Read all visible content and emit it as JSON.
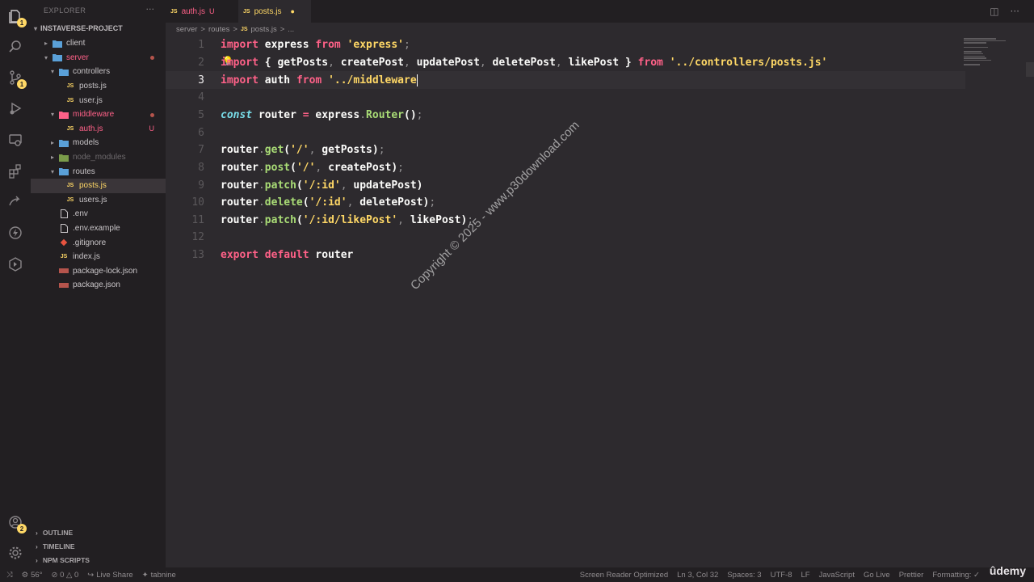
{
  "sidebar": {
    "title": "EXPLORER",
    "more": "···",
    "root": "INSTAVERSE-PROJECT",
    "items": [
      {
        "label": "client",
        "kind": "folder",
        "expanded": false,
        "indent": 1,
        "color": "#c9c5c8"
      },
      {
        "label": "server",
        "kind": "folder",
        "expanded": true,
        "indent": 1,
        "color": "#ff6188",
        "mark": "dot"
      },
      {
        "label": "controllers",
        "kind": "folder",
        "expanded": true,
        "indent": 2,
        "color": "#c9c5c8"
      },
      {
        "label": "posts.js",
        "kind": "js",
        "indent": 3,
        "color": "#c9c5c8"
      },
      {
        "label": "user.js",
        "kind": "js",
        "indent": 3,
        "color": "#c9c5c8"
      },
      {
        "label": "middleware",
        "kind": "folder",
        "expanded": true,
        "indent": 2,
        "color": "#ff6188",
        "mark": "dot"
      },
      {
        "label": "auth.js",
        "kind": "js",
        "indent": 3,
        "color": "#ff6188",
        "mark": "U"
      },
      {
        "label": "models",
        "kind": "folder",
        "expanded": false,
        "indent": 2,
        "color": "#c9c5c8"
      },
      {
        "label": "node_modules",
        "kind": "folder",
        "expanded": false,
        "indent": 2,
        "color": "#6d696c"
      },
      {
        "label": "routes",
        "kind": "folder",
        "expanded": true,
        "indent": 2,
        "color": "#c9c5c8"
      },
      {
        "label": "posts.js",
        "kind": "js",
        "indent": 3,
        "color": "#ffd866",
        "selected": true
      },
      {
        "label": "users.js",
        "kind": "js",
        "indent": 3,
        "color": "#c9c5c8"
      },
      {
        "label": ".env",
        "kind": "file",
        "indent": 2,
        "color": "#c9c5c8"
      },
      {
        "label": ".env.example",
        "kind": "file",
        "indent": 2,
        "color": "#c9c5c8"
      },
      {
        "label": ".gitignore",
        "kind": "git",
        "indent": 2,
        "color": "#c9c5c8"
      },
      {
        "label": "index.js",
        "kind": "js",
        "indent": 2,
        "color": "#c9c5c8"
      },
      {
        "label": "package-lock.json",
        "kind": "json",
        "indent": 2,
        "color": "#c9c5c8"
      },
      {
        "label": "package.json",
        "kind": "json",
        "indent": 2,
        "color": "#c9c5c8"
      }
    ],
    "sections": [
      "OUTLINE",
      "TIMELINE",
      "NPM SCRIPTS"
    ]
  },
  "activity": {
    "explorer_badge": "1",
    "scm_badge": "1",
    "accounts_badge": "2"
  },
  "tabs": [
    {
      "label": "auth.js",
      "status": "U",
      "js": "JS"
    },
    {
      "label": "posts.js",
      "status": "●",
      "js": "JS"
    }
  ],
  "breadcrumb": [
    "server",
    "routes",
    "posts.js",
    "..."
  ],
  "breadcrumb_sep": ">",
  "editor": {
    "lines": [
      {
        "n": "1",
        "tokens": [
          [
            "kw",
            "import"
          ],
          [
            "t",
            " express "
          ],
          [
            "kw",
            "from"
          ],
          [
            "t",
            " "
          ],
          [
            "str",
            "'express'"
          ],
          [
            "punc",
            ";"
          ]
        ]
      },
      {
        "n": "2",
        "tokens": [
          [
            "kw",
            "import"
          ],
          [
            "t",
            " { getPosts"
          ],
          [
            "punc",
            ","
          ],
          [
            "t",
            " createPost"
          ],
          [
            "punc",
            ","
          ],
          [
            "t",
            " updatePost"
          ],
          [
            "punc",
            ","
          ],
          [
            "t",
            " deletePost"
          ],
          [
            "punc",
            ","
          ],
          [
            "t",
            " likePost } "
          ],
          [
            "kw",
            "from"
          ],
          [
            "t",
            " "
          ],
          [
            "str",
            "'../controllers/posts.js'"
          ]
        ]
      },
      {
        "n": "3",
        "current": true,
        "tokens": [
          [
            "kw",
            "import"
          ],
          [
            "t",
            " auth "
          ],
          [
            "kw",
            "from"
          ],
          [
            "t",
            " "
          ],
          [
            "str",
            "'../middleware"
          ],
          [
            "cursor",
            ""
          ]
        ]
      },
      {
        "n": "4",
        "tokens": []
      },
      {
        "n": "5",
        "tokens": [
          [
            "const",
            "const"
          ],
          [
            "t",
            " router "
          ],
          [
            "kw",
            "="
          ],
          [
            "t",
            " express"
          ],
          [
            "punc",
            "."
          ],
          [
            "fn",
            "Router"
          ],
          [
            "t",
            "()"
          ],
          [
            "punc",
            ";"
          ]
        ]
      },
      {
        "n": "6",
        "tokens": []
      },
      {
        "n": "7",
        "tokens": [
          [
            "t",
            "router"
          ],
          [
            "punc",
            "."
          ],
          [
            "fn",
            "get"
          ],
          [
            "t",
            "("
          ],
          [
            "str",
            "'/'"
          ],
          [
            "punc",
            ","
          ],
          [
            "t",
            " getPosts)"
          ],
          [
            "punc",
            ";"
          ]
        ]
      },
      {
        "n": "8",
        "tokens": [
          [
            "t",
            "router"
          ],
          [
            "punc",
            "."
          ],
          [
            "fn",
            "post"
          ],
          [
            "t",
            "("
          ],
          [
            "str",
            "'/'"
          ],
          [
            "punc",
            ","
          ],
          [
            "t",
            " createPost)"
          ],
          [
            "punc",
            ";"
          ]
        ]
      },
      {
        "n": "9",
        "tokens": [
          [
            "t",
            "router"
          ],
          [
            "punc",
            "."
          ],
          [
            "fn",
            "patch"
          ],
          [
            "t",
            "("
          ],
          [
            "str",
            "'/:id'"
          ],
          [
            "punc",
            ","
          ],
          [
            "t",
            " updatePost)"
          ]
        ]
      },
      {
        "n": "10",
        "tokens": [
          [
            "t",
            "router"
          ],
          [
            "punc",
            "."
          ],
          [
            "fn",
            "delete"
          ],
          [
            "t",
            "("
          ],
          [
            "str",
            "'/:id'"
          ],
          [
            "punc",
            ","
          ],
          [
            "t",
            " deletePost)"
          ],
          [
            "punc",
            ";"
          ]
        ]
      },
      {
        "n": "11",
        "tokens": [
          [
            "t",
            "router"
          ],
          [
            "punc",
            "."
          ],
          [
            "fn",
            "patch"
          ],
          [
            "t",
            "("
          ],
          [
            "str",
            "'/:id/likePost'"
          ],
          [
            "punc",
            ","
          ],
          [
            "t",
            " likePost)"
          ],
          [
            "punc",
            ";"
          ]
        ]
      },
      {
        "n": "12",
        "tokens": []
      },
      {
        "n": "13",
        "tokens": [
          [
            "kw",
            "export"
          ],
          [
            "t",
            " "
          ],
          [
            "kw",
            "default"
          ],
          [
            "t",
            " router"
          ]
        ]
      }
    ]
  },
  "watermark": "Copyright © 2025 - www.p30download.com",
  "status": {
    "left": [
      "56°",
      "⊘ 0 △ 0",
      "Live Share",
      "tabnine"
    ],
    "right": [
      "Screen Reader Optimized",
      "Ln 3, Col 32",
      "Spaces: 3",
      "UTF-8",
      "LF",
      "JavaScript",
      "Go Live",
      "Prettier",
      "Formatting: ✓"
    ]
  },
  "brand": "ûdemy",
  "colors": {
    "keyword": "#ff6188",
    "string": "#ffd866",
    "function": "#a9dc76",
    "const": "#78dce8",
    "background": "#2d2a2e"
  }
}
